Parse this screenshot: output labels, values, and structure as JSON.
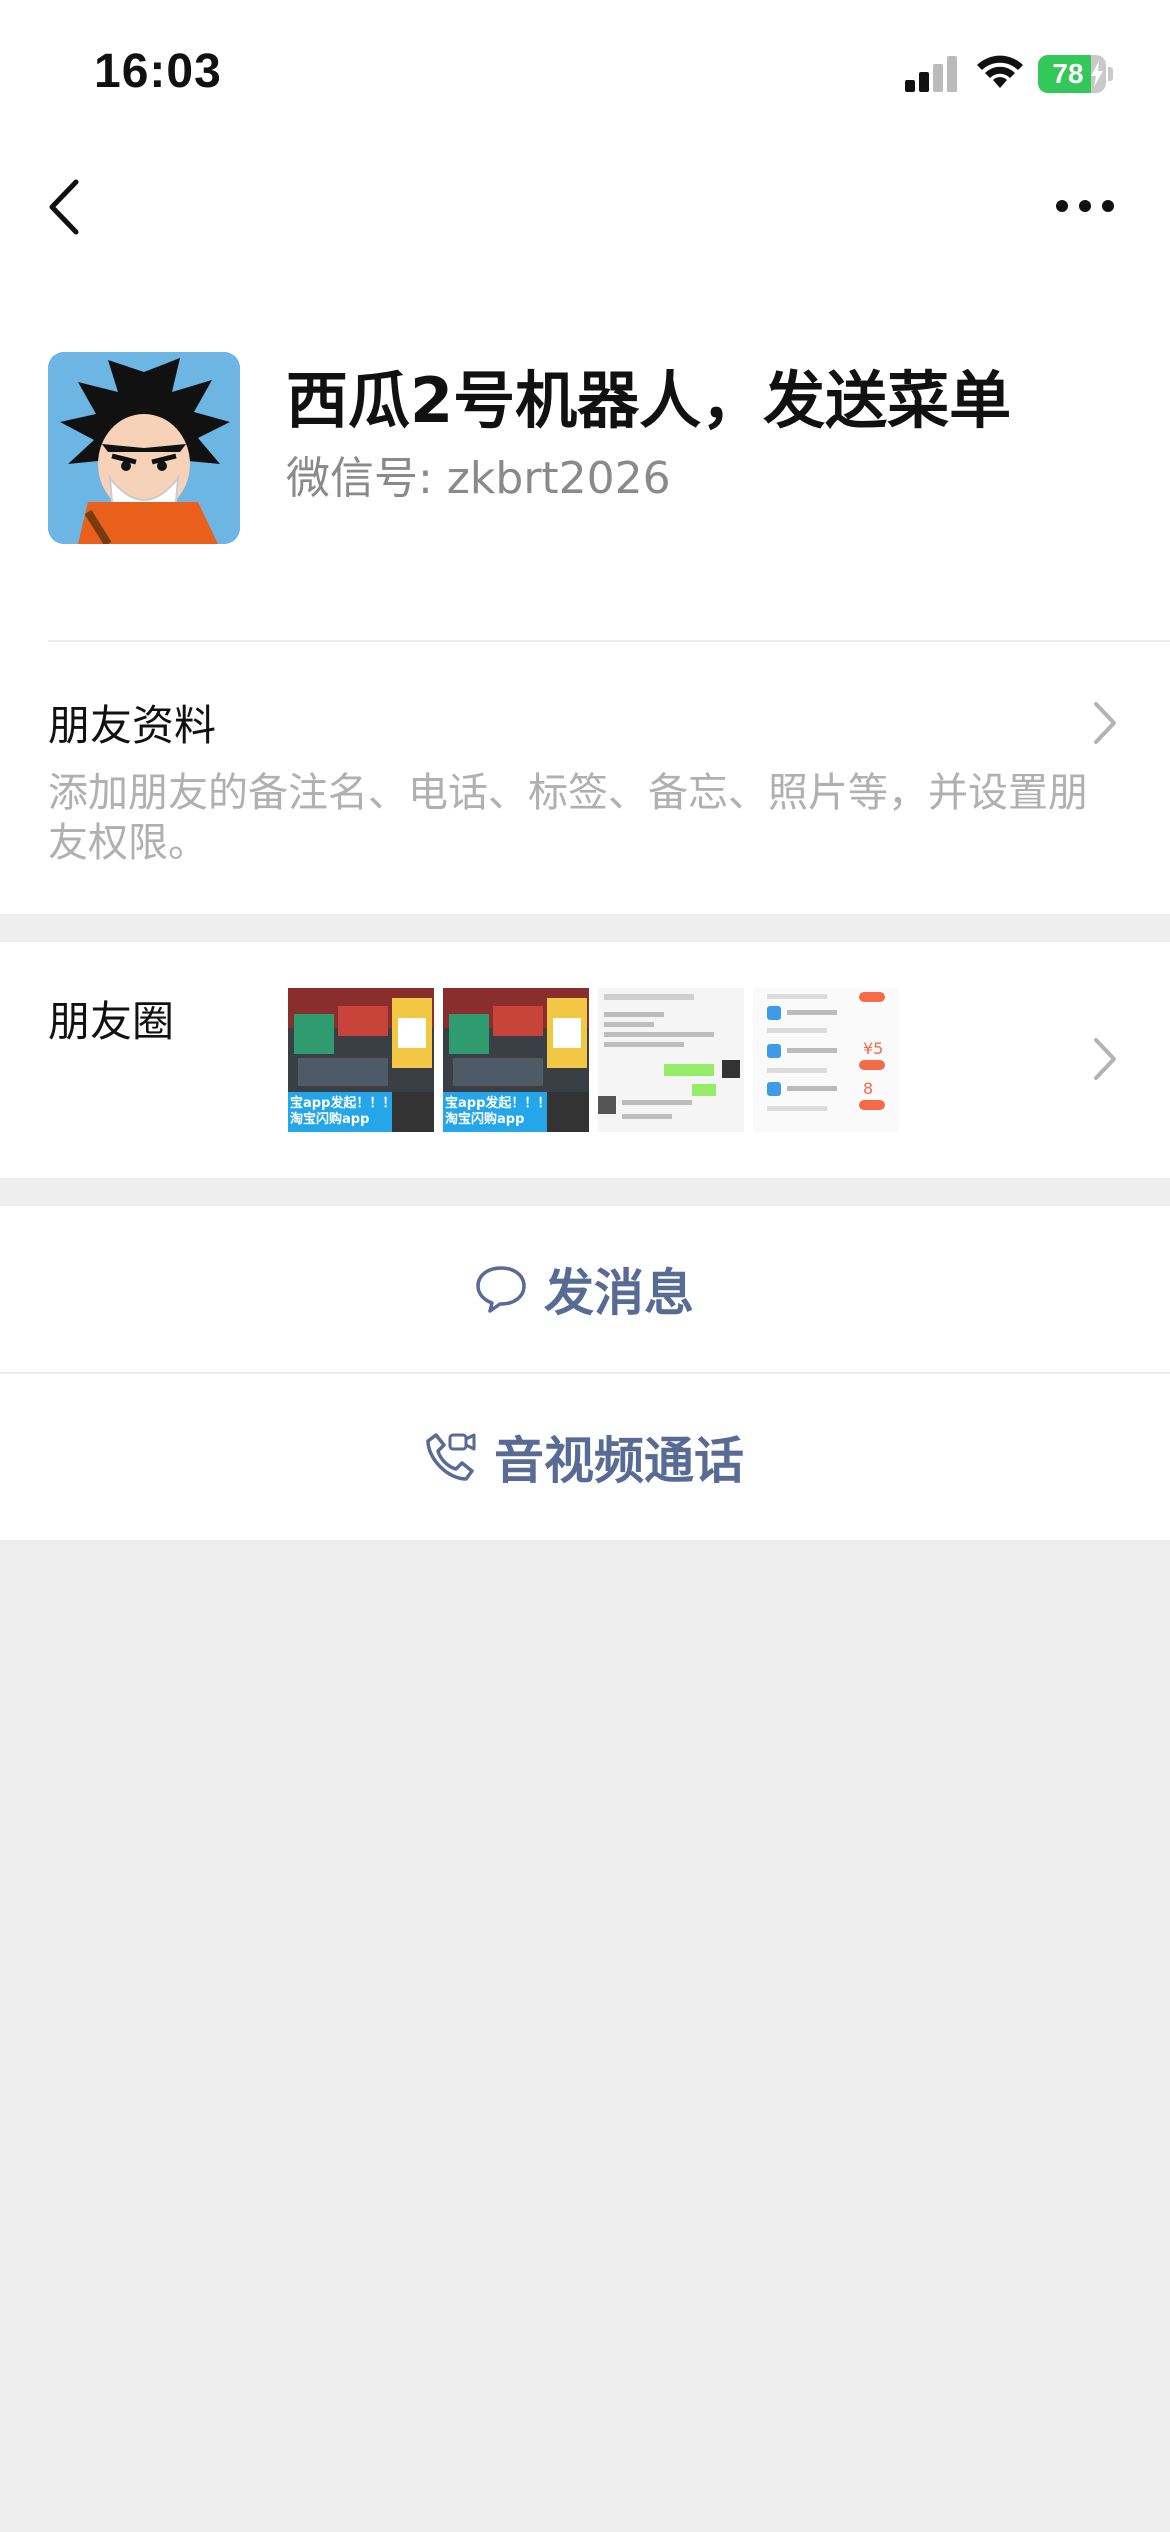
{
  "status_bar": {
    "time": "16:03",
    "battery_percent": 78,
    "battery_label": "78",
    "charging": true,
    "battery_color": "#34c759"
  },
  "nav": {
    "back_icon": "chevron-left-icon",
    "more_icon": "more-horizontal-icon"
  },
  "profile": {
    "name": "西瓜2号机器人，发送菜单",
    "wechat_id": "微信号: zkbrt2026"
  },
  "friend_info": {
    "title": "朋友资料",
    "description": "添加朋友的备注名、电话、标签、备忘、照片等，并设置朋友权限。"
  },
  "moments": {
    "title": "朋友圈",
    "thumbnails": [
      {
        "caption_line1": "宝app发起！！！",
        "caption_line2": "淘宝闪购app"
      },
      {
        "caption_line1": "宝app发起！！！",
        "caption_line2": "淘宝闪购app"
      },
      {
        "caption_line1": "",
        "caption_line2": ""
      },
      {
        "caption_line1": "",
        "caption_line2": ""
      }
    ]
  },
  "actions": {
    "send_message": "发消息",
    "av_call": "音视频通话"
  },
  "colors": {
    "link_blue": "#576b95",
    "background_gray": "#ededed",
    "secondary_text": "#8a8a8a"
  }
}
